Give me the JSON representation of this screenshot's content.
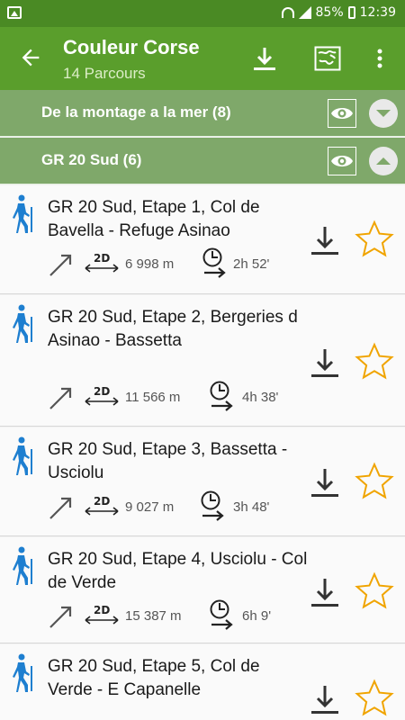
{
  "statusbar": {
    "battery": "85%",
    "time": "12:39"
  },
  "appbar": {
    "title": "Couleur Corse",
    "subtitle": "14 Parcours"
  },
  "groups": [
    {
      "title": "De la montage a la mer (8)"
    },
    {
      "title": "GR 20 Sud (6)"
    }
  ],
  "items": [
    {
      "name": " GR 20 Sud, Etape 1, Col de Bavella - Refuge Asinao",
      "distance": "6 998 m",
      "duration": "2h 52'"
    },
    {
      "name": " GR 20 Sud, Etape 2, Bergeries d Asinao - Bassetta",
      "distance": "11 566 m",
      "duration": "4h 38'"
    },
    {
      "name": " GR 20 Sud, Etape 3, Bassetta - Usciolu",
      "distance": "9 027 m",
      "duration": "3h 48'"
    },
    {
      "name": " GR 20 Sud, Etape 4, Usciolu - Col de Verde",
      "distance": "15 387 m",
      "duration": "6h 9'"
    },
    {
      "name": " GR 20 Sud, Etape 5, Col de Verde - E Capanelle",
      "distance": "",
      "duration": ""
    }
  ],
  "colors": {
    "appbar": "#5a9e2c",
    "group": "#7fa86a",
    "star": "#f0a400",
    "hiker": "#1e7fd0"
  }
}
